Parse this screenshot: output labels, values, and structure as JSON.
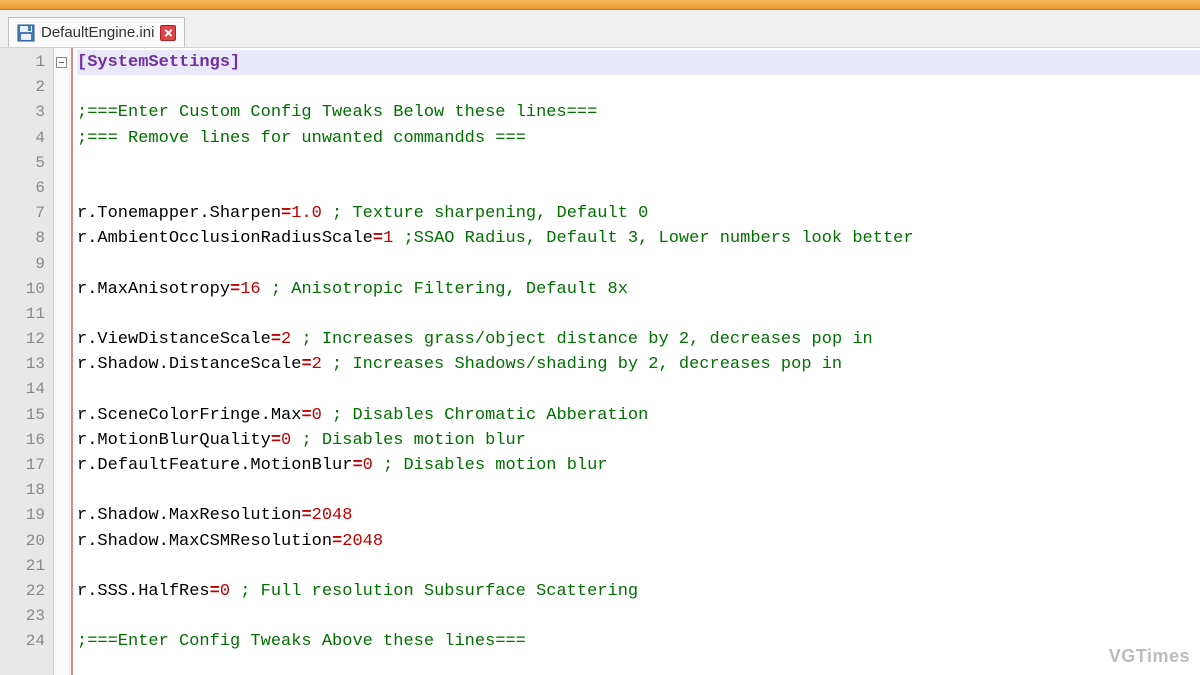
{
  "tab": {
    "filename": "DefaultEngine.ini"
  },
  "watermark": "VGTimes",
  "lines": [
    {
      "n": 1,
      "fold": true,
      "type": "section",
      "section": "[SystemSettings]",
      "hl": true
    },
    {
      "n": 2,
      "type": "blank"
    },
    {
      "n": 3,
      "type": "comment",
      "text": ";===Enter Custom Config Tweaks Below these lines==="
    },
    {
      "n": 4,
      "type": "comment",
      "text": ";=== Remove lines for unwanted commandds ==="
    },
    {
      "n": 5,
      "type": "blank"
    },
    {
      "n": 6,
      "type": "blank"
    },
    {
      "n": 7,
      "type": "setting",
      "key": "r.Tonemapper.Sharpen",
      "value": "1.0",
      "trail": " ; Texture sharpening, Default 0"
    },
    {
      "n": 8,
      "type": "setting",
      "key": "r.AmbientOcclusionRadiusScale",
      "value": "1",
      "trail": " ;SSAO Radius, Default 3, Lower numbers look better"
    },
    {
      "n": 9,
      "type": "blank"
    },
    {
      "n": 10,
      "type": "setting",
      "key": "r.MaxAnisotropy",
      "value": "16",
      "trail": " ; Anisotropic Filtering, Default 8x"
    },
    {
      "n": 11,
      "type": "blank"
    },
    {
      "n": 12,
      "type": "setting",
      "key": "r.ViewDistanceScale",
      "value": "2",
      "trail": " ; Increases grass/object distance by 2, decreases pop in"
    },
    {
      "n": 13,
      "type": "setting",
      "key": "r.Shadow.DistanceScale",
      "value": "2",
      "trail": " ; Increases Shadows/shading by 2, decreases pop in"
    },
    {
      "n": 14,
      "type": "blank"
    },
    {
      "n": 15,
      "type": "setting",
      "key": "r.SceneColorFringe.Max",
      "value": "0",
      "trail": " ; Disables Chromatic Abberation"
    },
    {
      "n": 16,
      "type": "setting",
      "key": "r.MotionBlurQuality",
      "value": "0",
      "trail": " ; Disables motion blur"
    },
    {
      "n": 17,
      "type": "setting",
      "key": "r.DefaultFeature.MotionBlur",
      "value": "0",
      "trail": " ; Disables motion blur"
    },
    {
      "n": 18,
      "type": "blank"
    },
    {
      "n": 19,
      "type": "setting",
      "key": "r.Shadow.MaxResolution",
      "value": "2048",
      "trail": ""
    },
    {
      "n": 20,
      "type": "setting",
      "key": "r.Shadow.MaxCSMResolution",
      "value": "2048",
      "trail": ""
    },
    {
      "n": 21,
      "type": "blank"
    },
    {
      "n": 22,
      "type": "setting",
      "key": "r.SSS.HalfRes",
      "value": "0",
      "trail": " ; Full resolution Subsurface Scattering"
    },
    {
      "n": 23,
      "type": "blank"
    },
    {
      "n": 24,
      "type": "comment",
      "text": ";===Enter Config Tweaks Above these lines==="
    }
  ]
}
